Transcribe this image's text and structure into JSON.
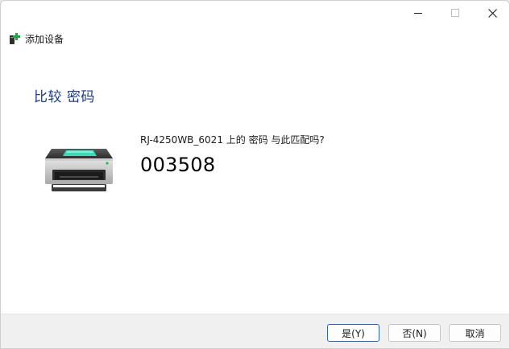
{
  "window": {
    "title": "添加设备",
    "controls": {
      "minimize_icon": "minimize-icon",
      "maximize_icon": "maximize-icon",
      "close_icon": "close-icon"
    }
  },
  "main": {
    "heading": "比较 密码",
    "question": "RJ-4250WB_6021 上的 密码 与此匹配吗?",
    "pin": "003508",
    "device_icon": "printer-icon"
  },
  "footer": {
    "yes_label": "是(Y)",
    "no_label": "否(N)",
    "cancel_label": "取消"
  },
  "colors": {
    "heading": "#1e3c8a",
    "default_button_border": "#2b63c7",
    "footer_background": "#f0f0f0"
  }
}
